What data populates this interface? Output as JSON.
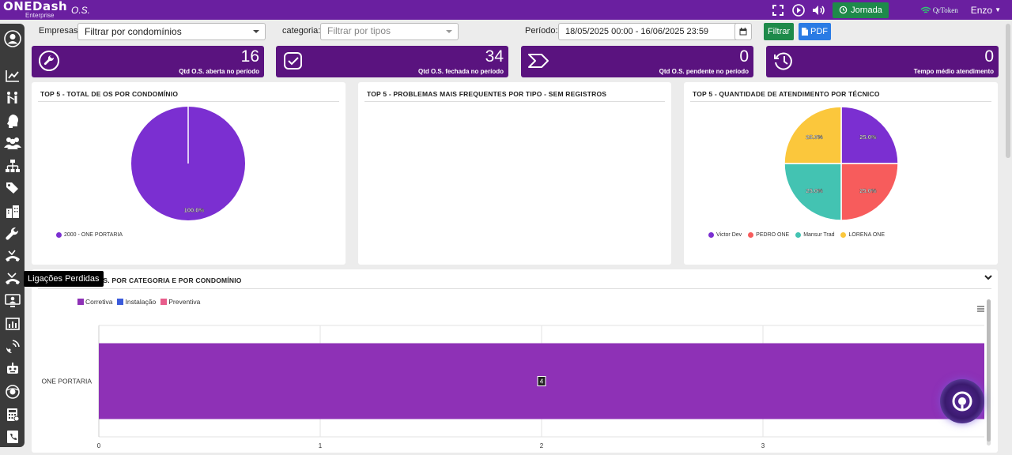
{
  "app": {
    "logo_main": "ONEDash",
    "logo_sub": "Enterprise",
    "page_title": "O.S.",
    "jornada_label": "Jornada",
    "qrtoken_label": "QrToken",
    "user_name": "Enzo"
  },
  "sidebar": {
    "items": [
      "user-avatar-icon",
      "chart-icon",
      "people-line-icon",
      "head-icon",
      "group-icon",
      "org-chart-icon",
      "tag-icon",
      "building-icon",
      "wrench-icon",
      "call-forward-icon",
      "call-missed-icon",
      "monitor-user-icon",
      "bar-report-icon",
      "satellite-icon",
      "robot-icon",
      "globe-icon",
      "calculator-icon",
      "phone-book-icon"
    ],
    "tooltip": "Ligações Perdidas"
  },
  "filters": {
    "empresas_label": "Empresas:",
    "empresas_value": "Filtrar por condomínios",
    "categoria_label": "categoria:",
    "categoria_placeholder": "Filtrar por tipos",
    "periodo_label": "Período:",
    "periodo_value": "18/05/2025 00:00 - 16/06/2025 23:59",
    "filtrar_label": "Filtrar",
    "pdf_label": "PDF"
  },
  "kpis": [
    {
      "value": "16",
      "label": "Qtd O.S. aberta no período",
      "icon": "wrench-circle-icon"
    },
    {
      "value": "34",
      "label": "Qtd O.S. fechada no período",
      "icon": "check-square-icon"
    },
    {
      "value": "0",
      "label": "Qtd O.S. pendente no período",
      "icon": "chevron-tag-icon"
    },
    {
      "value": "0",
      "label": "Tempo médio atendimento",
      "icon": "clock-history-icon"
    }
  ],
  "panels": {
    "p1_title": "TOP 5 - TOTAL DE OS POR CONDOMÍNIO",
    "p2_title": "TOP 5 - PROBLEMAS MAIS FREQUENTES POR TIPO - SEM REGISTROS",
    "p3_title": "TOP 5 - QUANTIDADE DE ATENDIMENTO POR TÉCNICO",
    "bottom_title": "O.S. POR CATEGORIA E POR CONDOMÍNIO"
  },
  "colors": {
    "purple_top": "#6a1fa0",
    "kpi": "#5a137f",
    "purple_series": "#7b2fd1",
    "bar": "#8e31b6",
    "red": "#f75c5c",
    "teal": "#43c3b2",
    "yellow": "#fbc73c",
    "green_btn": "#1e8a4a",
    "blue_btn": "#2a7be4"
  },
  "chart_data": [
    {
      "type": "pie",
      "title": "TOP 5 - TOTAL DE OS POR CONDOMÍNIO",
      "slices": [
        {
          "name": "2000 - ONE PORTARIA",
          "value": 100.0,
          "label": "100.0%",
          "color": "#7b2fd1"
        }
      ]
    },
    {
      "type": "pie",
      "title": "TOP 5 - QUANTIDADE DE ATENDIMENTO POR TÉCNICO",
      "slices": [
        {
          "name": "Victor Dev",
          "value": 25.0,
          "label": "25.0%",
          "color": "#7b2fd1"
        },
        {
          "name": "PEDRO ONE",
          "value": 25.0,
          "label": "25.0%",
          "color": "#f75c5c"
        },
        {
          "name": "Mansur Trad",
          "value": 25.0,
          "label": "25.0%",
          "color": "#43c3b2"
        },
        {
          "name": "LORENA ONE",
          "value": 25.0,
          "label": "25.0%",
          "color": "#fbc73c"
        }
      ]
    },
    {
      "type": "bar",
      "orientation": "horizontal",
      "title": "O.S. POR CATEGORIA E POR CONDOMÍNIO",
      "categories": [
        "ONE PORTARIA"
      ],
      "series": [
        {
          "name": "Corretiva",
          "values": [
            4
          ],
          "color": "#8e31b6"
        },
        {
          "name": "Instalação",
          "values": [
            0
          ],
          "color": "#3b5bdb"
        },
        {
          "name": "Preventiva",
          "values": [
            0
          ],
          "color": "#e85d8c"
        }
      ],
      "data_labels": [
        "4"
      ],
      "x_ticks": [
        "0",
        "1",
        "2",
        "3"
      ],
      "xlim": [
        0,
        4
      ]
    }
  ]
}
